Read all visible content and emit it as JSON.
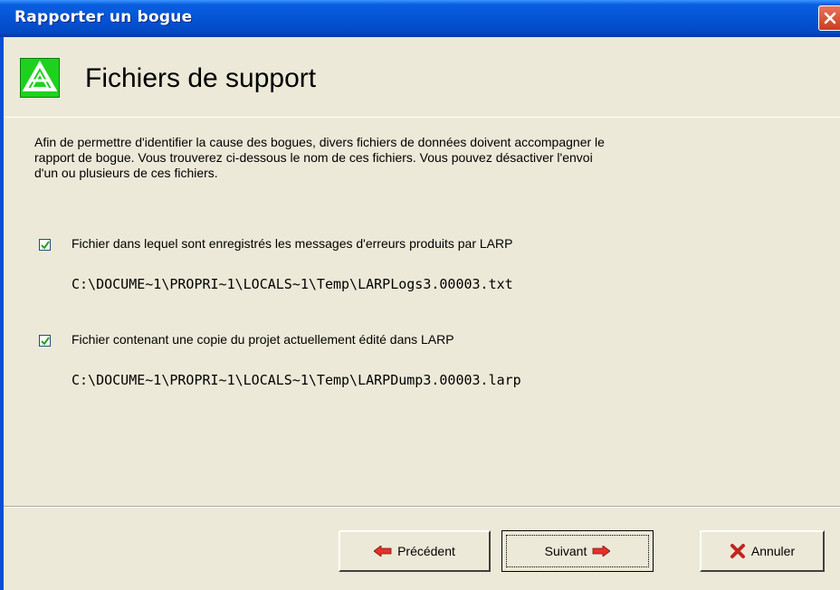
{
  "window": {
    "title": "Rapporter un bogue"
  },
  "header": {
    "title": "Fichiers de support"
  },
  "description": {
    "lines": [
      "Afin de permettre d'identifier la cause des bogues, divers fichiers de données doivent accompagner le",
      "rapport de bogue. Vous trouverez ci-dessous le nom de ces fichiers. Vous pouvez désactiver l'envoi",
      "d'un ou plusieurs de ces fichiers."
    ]
  },
  "files": [
    {
      "checked": true,
      "label": "Fichier dans lequel sont enregistrés les messages d'erreurs produits par LARP",
      "path": "C:\\DOCUME~1\\PROPRI~1\\LOCALS~1\\Temp\\LARPLogs3.00003.txt"
    },
    {
      "checked": true,
      "label": "Fichier contenant une copie du projet actuellement édité dans LARP",
      "path": "C:\\DOCUME~1\\PROPRI~1\\LOCALS~1\\Temp\\LARPDump3.00003.larp"
    }
  ],
  "buttons": {
    "previous": "Précédent",
    "next": "Suivant",
    "cancel": "Annuler"
  },
  "colors": {
    "titlebar": "#0554d6",
    "logo": "#1fd11f",
    "arrow": "#e8302a",
    "cancel_x": "#c0261e"
  },
  "icons": {
    "close": "close-icon",
    "logo": "app-logo-icon",
    "previous": "arrow-left-icon",
    "next": "arrow-right-icon",
    "cancel": "cancel-x-icon"
  }
}
